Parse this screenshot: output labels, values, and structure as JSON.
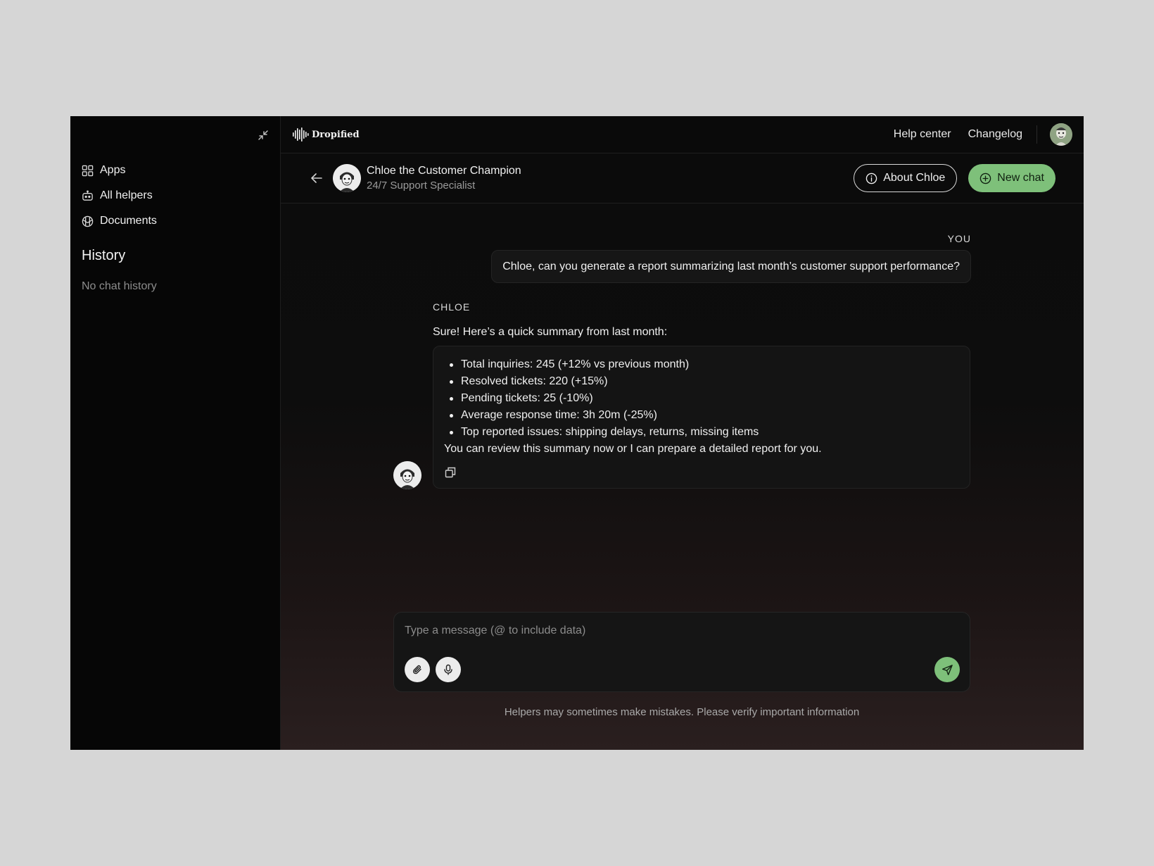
{
  "sidebar": {
    "nav": [
      {
        "label": "Apps",
        "icon": "grid-icon"
      },
      {
        "label": "All helpers",
        "icon": "robot-icon"
      },
      {
        "label": "Documents",
        "icon": "globe-doc-icon"
      }
    ],
    "history_title": "History",
    "history_empty": "No chat history"
  },
  "topbar": {
    "logo_text": "Dropified",
    "links": [
      "Help center",
      "Changelog"
    ]
  },
  "chat_header": {
    "bot_name": "Chloe the Customer Champion",
    "bot_role": "24/7 Support Specialist",
    "about_button": "About Chloe",
    "new_chat_button": "New chat"
  },
  "messages": {
    "user_label": "YOU",
    "user_text": "Chloe, can you generate a report summarizing last month’s customer support performance?",
    "bot_label": "CHLOE",
    "bot_intro": "Sure! Here’s a quick summary from last month:",
    "bot_bullets": [
      "Total inquiries: 245 (+12% vs previous month)",
      "Resolved tickets: 220 (+15%)",
      "Pending tickets: 25 (-10%)",
      "Average response time: 3h 20m (-25%)",
      "Top reported issues: shipping delays, returns, missing items"
    ],
    "bot_footer": "You can review this summary now or I can prepare a detailed report for you."
  },
  "composer": {
    "placeholder": "Type a message (@ to include data)",
    "value": ""
  },
  "disclaimer": "Helpers may sometimes make mistakes. Please verify important information",
  "colors": {
    "accent_green": "#7ec07a",
    "background": "#0a0a0a",
    "page_bg": "#d6d6d6"
  }
}
